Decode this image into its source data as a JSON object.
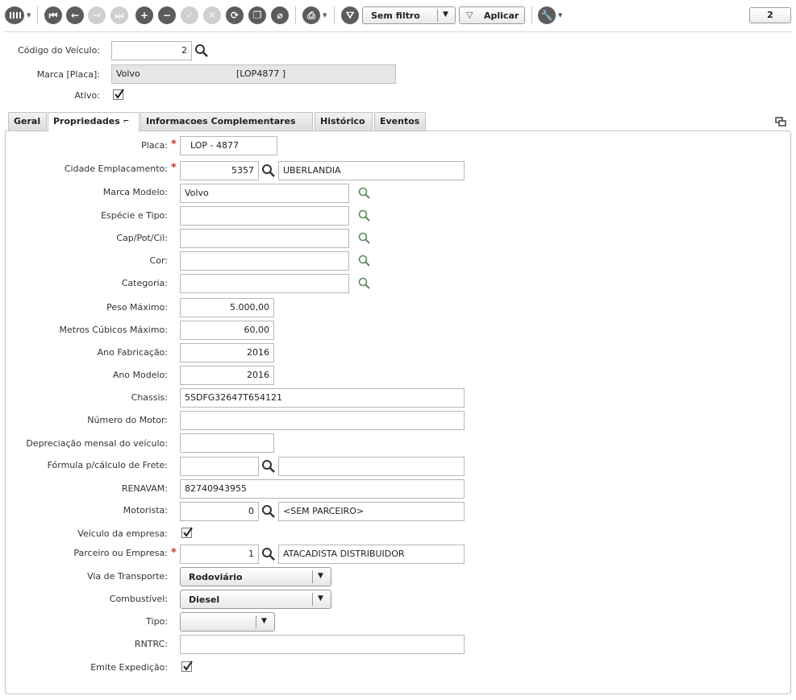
{
  "toolbar": {
    "filter_label": "Sem filtro",
    "apply_label": "Aplicar",
    "page_count": "2"
  },
  "header": {
    "codigo_label": "Código do Veículo:",
    "codigo_value": "2",
    "marca_label": "Marca [Placa]:",
    "marca_value": "Volvo",
    "placa_value": "[LOP4877   ]",
    "ativo_label": "Ativo:"
  },
  "tabs": [
    {
      "label": "Geral"
    },
    {
      "label": "Propriedades"
    },
    {
      "label": "Informacoes Complementares"
    },
    {
      "label": "Histórico"
    },
    {
      "label": "Eventos"
    }
  ],
  "form": {
    "placa": {
      "label": "Placa:",
      "value": "LOP  -   4877"
    },
    "cidade": {
      "label": "Cidade Emplacamento:",
      "code": "5357",
      "desc": "UBERLANDIA"
    },
    "marca_modelo": {
      "label": "Marca Modelo:",
      "value": "Volvo"
    },
    "especie": {
      "label": "Espécie e Tipo:",
      "value": ""
    },
    "cap": {
      "label": "Cap/Pot/Cil:",
      "value": ""
    },
    "cor": {
      "label": "Cor:",
      "value": ""
    },
    "categoria": {
      "label": "Categoria:",
      "value": ""
    },
    "peso": {
      "label": "Peso Máximo:",
      "value": "5.000,00"
    },
    "metros": {
      "label": "Metros Cúbicos Máximo:",
      "value": "60,00"
    },
    "ano_fab": {
      "label": "Ano Fabricação:",
      "value": "2016"
    },
    "ano_mod": {
      "label": "Ano Modelo:",
      "value": "2016"
    },
    "chassis": {
      "label": "Chassis:",
      "value": "5SDFG32647T654121"
    },
    "motor": {
      "label": "Número do Motor:",
      "value": ""
    },
    "depreciacao": {
      "label": "Depreciação mensal do veículo:",
      "value": ""
    },
    "formula": {
      "label": "Fórmula p/cálculo de Frete:",
      "code": "",
      "desc": ""
    },
    "renavam": {
      "label": "RENAVAM:",
      "value": "82740943955"
    },
    "motorista": {
      "label": "Motorista:",
      "code": "0",
      "desc": "<SEM PARCEIRO>"
    },
    "veiculo_empresa": {
      "label": "Veículo da empresa:"
    },
    "parceiro": {
      "label": "Parceiro ou Empresa:",
      "code": "1",
      "desc": "ATACADISTA DISTRIBUIDOR"
    },
    "via": {
      "label": "Via de Transporte:",
      "value": "Rodoviário"
    },
    "combustivel": {
      "label": "Combustível:",
      "value": "Diesel"
    },
    "tipo": {
      "label": "Tipo:",
      "value": ""
    },
    "rntrc": {
      "label": "RNTRC:",
      "value": ""
    },
    "emite": {
      "label": "Emite Expedição:"
    }
  },
  "colors": {
    "required": "#d9302a",
    "toolbar_icon": "#5c5c5c",
    "toolbar_icon_disabled": "#cfcfcf"
  }
}
